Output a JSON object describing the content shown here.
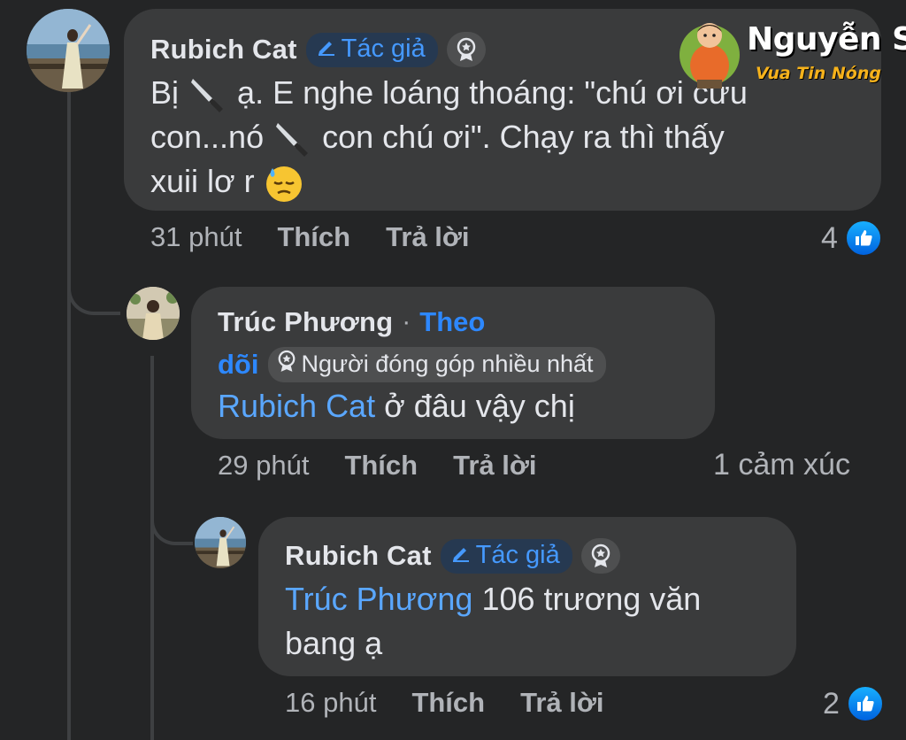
{
  "watermark": {
    "name": "Nguyễn Sin",
    "tagline": "Vua Tin Nóng",
    "mascot_icon": "mascot-character-icon"
  },
  "comments": [
    {
      "author": "Rubich Cat",
      "author_badge": "Tác giả",
      "text_parts": [
        "Bị",
        "ạ. E nghe loáng thoáng: \"chú ơi cứu",
        "con...nó",
        "con chú ơi\". Chạy ra thì thấy",
        "xuii lơ r"
      ],
      "emoji": [
        "knife",
        "knife",
        "downcast-sweat-face"
      ],
      "time": "31 phút",
      "like_label": "Thích",
      "reply_label": "Trả lời",
      "reaction_count": "4"
    },
    {
      "author": "Trúc Phương",
      "separator": "·",
      "follow_label_1": "Theo",
      "follow_label_2": "dõi",
      "contributor_badge": "Người đóng góp nhiều nhất",
      "mention": "Rubich Cat",
      "text": " ở đâu vậy chị",
      "time": "29 phút",
      "like_label": "Thích",
      "reply_label": "Trả lời",
      "reaction_summary": "1 cảm xúc"
    },
    {
      "author": "Rubich Cat",
      "author_badge": "Tác giả",
      "mention": "Trúc Phương",
      "text_line1": " 106 trương văn",
      "text_line2": "bang ạ",
      "time": "16 phút",
      "like_label": "Thích",
      "reply_label": "Trả lời",
      "reaction_count": "2"
    }
  ],
  "colors": {
    "background": "#242526",
    "bubble": "#3a3b3c",
    "accent": "#2d88ff",
    "mention": "#5aa7ff"
  }
}
